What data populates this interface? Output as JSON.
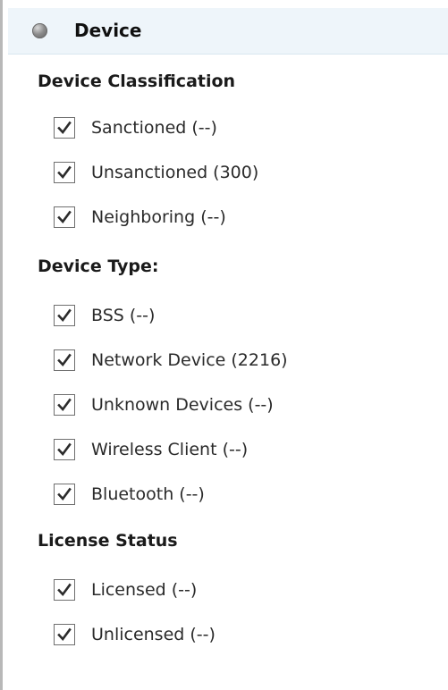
{
  "header": {
    "title": "Device",
    "status_icon": "status-dot-icon"
  },
  "sections": [
    {
      "title": "Device Classification",
      "items": [
        {
          "label": "Sanctioned (--)",
          "checked": true
        },
        {
          "label": "Unsanctioned (300)",
          "checked": true
        },
        {
          "label": "Neighboring (--)",
          "checked": true
        }
      ]
    },
    {
      "title": "Device Type:",
      "items": [
        {
          "label": "BSS (--)",
          "checked": true
        },
        {
          "label": "Network Device (2216)",
          "checked": true
        },
        {
          "label": "Unknown Devices (--)",
          "checked": true
        },
        {
          "label": "Wireless Client (--)",
          "checked": true
        },
        {
          "label": "Bluetooth (--)",
          "checked": true
        }
      ]
    },
    {
      "title": "License Status",
      "items": [
        {
          "label": "Licensed (--)",
          "checked": true
        },
        {
          "label": "Unlicensed (--)",
          "checked": true
        }
      ]
    }
  ],
  "colors": {
    "header_background": "#eef5fa",
    "left_border": "#b8b8b8",
    "checkmark": "#2b2b2b"
  }
}
